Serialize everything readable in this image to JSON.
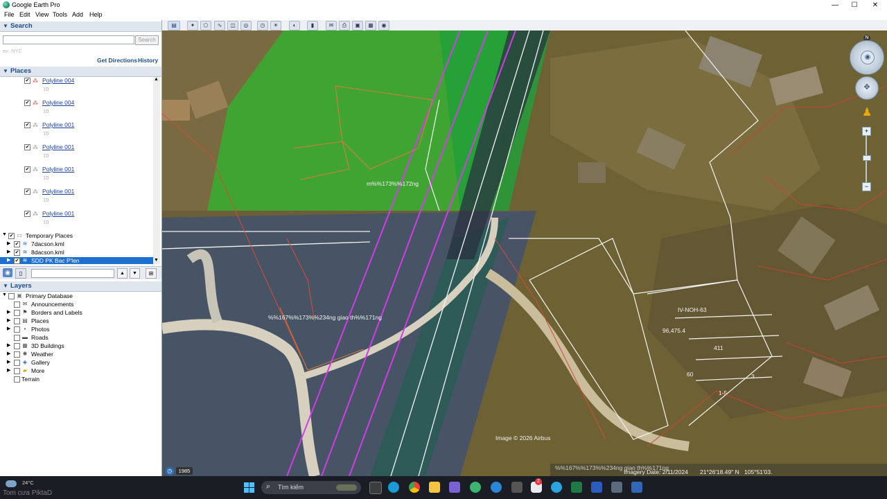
{
  "window": {
    "title": "Google Earth Pro",
    "minimize": "—",
    "maximize": "☐",
    "close": "✕"
  },
  "menu": [
    "File",
    "Edit",
    "View",
    "Tools",
    "Add",
    "Help"
  ],
  "search": {
    "header": "Search",
    "placeholder": "",
    "button": "Search",
    "hint": "ex: NYC",
    "get_directions": "Get Directions",
    "history": "History"
  },
  "places": {
    "header": "Places",
    "items": [
      {
        "name": "Polyline 004",
        "sub": "10",
        "color": "#c0392b"
      },
      {
        "name": "Polyline 004",
        "sub": "10",
        "color": "#c0392b"
      },
      {
        "name": "Polyline 001",
        "sub": "10",
        "color": "#888888"
      },
      {
        "name": "Polyline 001",
        "sub": "10",
        "color": "#888888"
      },
      {
        "name": "Polyline 001",
        "sub": "10",
        "color": "#888888"
      },
      {
        "name": "Polyline 001",
        "sub": "10",
        "color": "#888888"
      },
      {
        "name": "Polyline 001",
        "sub": "10",
        "color": "#888888"
      }
    ],
    "temporary": "Temporary Places",
    "kml": [
      "7dacson.kml",
      "8dacson.kml",
      "SDD PK Bac P'len"
    ]
  },
  "layers": {
    "header": "Layers",
    "root": "Primary Database",
    "items": [
      "Announcements",
      "Borders and Labels",
      "Places",
      "Photos",
      "Roads",
      "3D Buildings",
      "Weather",
      "Gallery",
      "More"
    ],
    "terrain": "Terrain"
  },
  "map": {
    "label_road_top": "m%%173%%172ng",
    "label_road_main": "%%167%%173%%234ng giao th%%171ng",
    "parcel_id": "IV-NOH-63",
    "parcel_area": "96,475.4",
    "n411": "411",
    "n60": "60",
    "n3": "3",
    "n15": "1-5",
    "credit": "Image © 2026 Airbus",
    "bottom_label": "%%167%%173%%234ng giao th%%171ng",
    "imagery_date": "Imagery Date: 2/11/2024",
    "lat": "21°26'18.49\" N",
    "lon": "105°51'03.",
    "historical_year": "1985",
    "north": "N"
  },
  "taskbar": {
    "weather_temp": "24°C",
    "weather_text": "Tom cưa PiktaD",
    "search_placeholder": "Tìm kiếm",
    "badge": "2"
  }
}
